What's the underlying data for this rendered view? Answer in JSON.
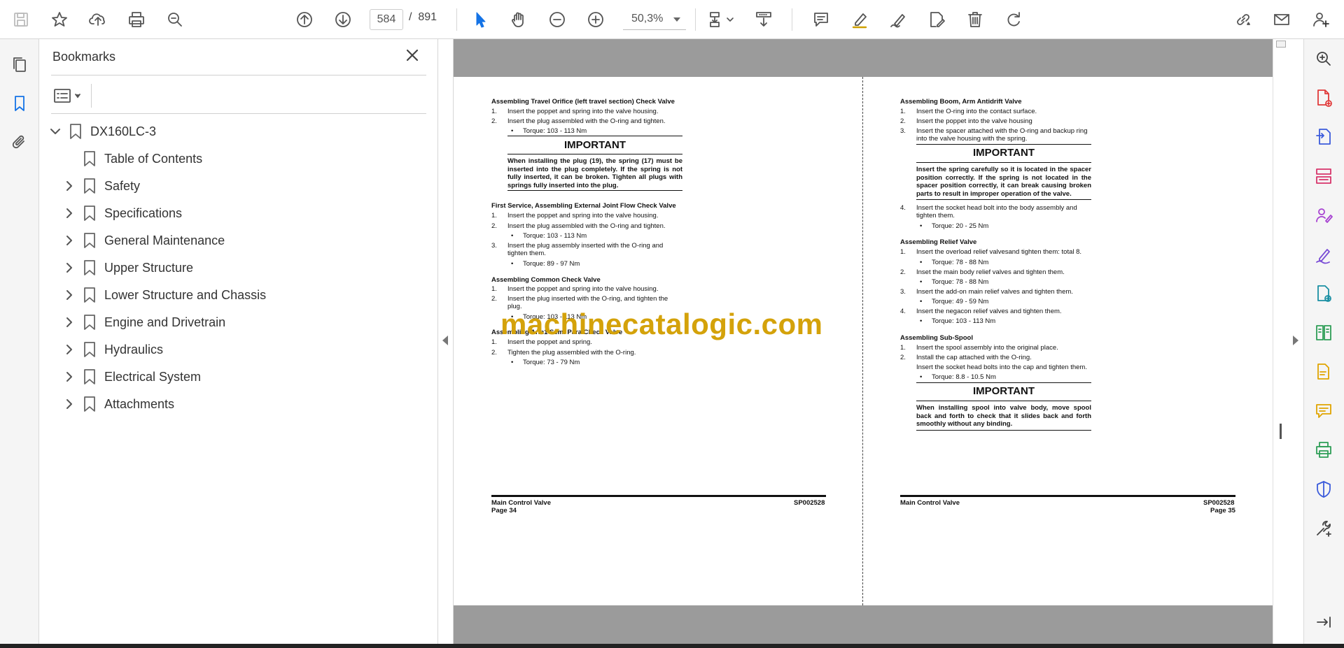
{
  "toolbar": {
    "current_page": "584",
    "page_separator": "/",
    "total_pages": "891",
    "zoom": "50,3%"
  },
  "bookmarks": {
    "title": "Bookmarks",
    "root": "DX160LC-3",
    "items": [
      {
        "label": "Table of Contents",
        "expandable": false
      },
      {
        "label": "Safety",
        "expandable": true
      },
      {
        "label": "Specifications",
        "expandable": true
      },
      {
        "label": "General Maintenance",
        "expandable": true
      },
      {
        "label": "Upper Structure",
        "expandable": true
      },
      {
        "label": "Lower Structure and Chassis",
        "expandable": true
      },
      {
        "label": "Engine and Drivetrain",
        "expandable": true
      },
      {
        "label": "Hydraulics",
        "expandable": true
      },
      {
        "label": "Electrical System",
        "expandable": true
      },
      {
        "label": "Attachments",
        "expandable": true
      }
    ]
  },
  "watermark": "machinecatalogic.com",
  "left_page": {
    "s1_title": "Assembling Travel Orifice (left travel section) Check Valve",
    "s1_n1": "1.",
    "s1_l1": "Insert the poppet and spring into the valve housing.",
    "s1_n2": "2.",
    "s1_l2": "Insert the plug assembled with the O-ring and tighten.",
    "s1_b1": "Torque: 103 - 113 Nm",
    "imp1_title": "IMPORTANT",
    "imp1_body": "When installing the plug (19), the spring (17) must be inserted into the plug completely. If the spring is not fully inserted, it can be broken. Tighten all plugs with springs fully inserted into the plug.",
    "s2_title": "First Service, Assembling External Joint Flow Check Valve",
    "s2_n1": "1.",
    "s2_l1": "Insert the poppet and spring into the valve housing.",
    "s2_n2": "2.",
    "s2_l2": "Insert the plug assembled with the O-ring and tighten.",
    "s2_b1": "Torque: 103 - 113 Nm",
    "s2_n3": "3.",
    "s2_l3a": "Insert the plug assembly inserted with the O-ring and",
    "s2_l3b": "tighten them.",
    "s2_b2": "Torque: 89 - 97 Nm",
    "s3_title": "Assembling Common Check Valve",
    "s3_n1": "1.",
    "s3_l1": "Insert the poppet and spring into the valve housing.",
    "s3_n2": "2.",
    "s3_l2a": "Insert the plug inserted with the O-ring, and tighten the",
    "s3_l2b": "plug.",
    "s3_b1": "Torque: 103 - 113 Nm",
    "s4_title": "Assembling Arm1 Semi Para Check Valve",
    "s4_n1": "1.",
    "s4_l1": "Insert the poppet and spring.",
    "s4_n2": "2.",
    "s4_l2": "Tighten the plug assembled with the O-ring.",
    "s4_b1": "Torque: 73 - 79 Nm",
    "footer_left_a": "Main Control Valve",
    "footer_left_b": "Page 34",
    "footer_right": "SP002528"
  },
  "right_page": {
    "s1_title": "Assembling Boom, Arm Antidrift Valve",
    "s1_n1": "1.",
    "s1_l1": "Insert the O-ring into the contact surface.",
    "s1_n2": "2.",
    "s1_l2": "Insert the poppet into the valve housing",
    "s1_n3": "3.",
    "s1_l3a": "Insert the spacer attached with the O-ring and backup ring",
    "s1_l3b": "into the valve housing with the spring.",
    "imp1_title": "IMPORTANT",
    "imp1_body": "Insert the spring carefully so it is located in the spacer position correctly. If the spring is not located in the spacer position correctly, it can break causing broken parts to result in improper operation of the valve.",
    "s1_n4": "4.",
    "s1_l4a": "Insert the socket head bolt into the body assembly and",
    "s1_l4b": "tighten them.",
    "s1_b1": "Torque: 20 - 25 Nm",
    "s2_title": "Assembling Relief Valve",
    "s2_n1": "1.",
    "s2_l1": "Insert the overload relief valvesand tighten them: total 8.",
    "s2_b1": "Torque: 78 - 88 Nm",
    "s2_n2": "2.",
    "s2_l2": "Inset the main body relief valves and tighten them.",
    "s2_b2": "Torque: 78 - 88 Nm",
    "s2_n3": "3.",
    "s2_l3": "Insert the add-on main relief valves and tighten them.",
    "s2_b3": "Torque: 49 - 59 Nm",
    "s2_n4": "4.",
    "s2_l4": "Insert the negacon relief valves and tighten them.",
    "s2_b4": "Torque: 103 - 113 Nm",
    "s3_title": "Assembling Sub-Spool",
    "s3_n1": "1.",
    "s3_l1": "Insert the spool assembly into the original place.",
    "s3_n2": "2.",
    "s3_l2": "Install the cap attached with the O-ring.",
    "s3_l3": "Insert the socket head bolts into the cap and tighten them.",
    "s3_b1": "Torque: 8.8 - 10.5 Nm",
    "imp2_title": "IMPORTANT",
    "imp2_body": "When installing spool into valve body, move spool back and forth to check that it slides back and forth smoothly without any binding.",
    "footer_left": "Main Control Valve",
    "footer_right_a": "SP002528",
    "footer_right_b": "Page 35"
  }
}
